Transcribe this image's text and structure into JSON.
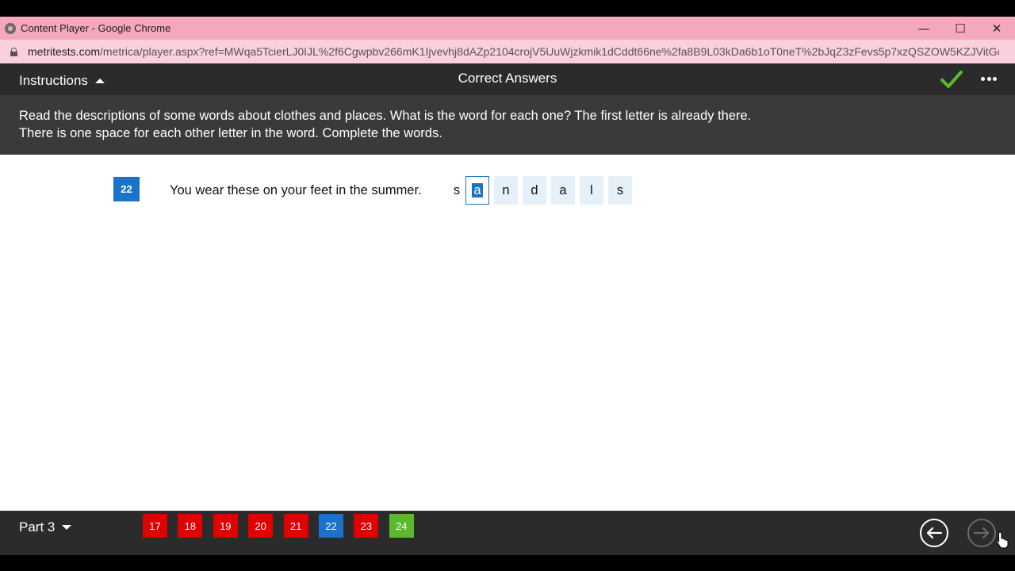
{
  "window": {
    "title": "Content Player - Google Chrome",
    "minimize_glyph": "—",
    "maximize_glyph": "☐",
    "close_glyph": "✕"
  },
  "browser": {
    "url_domain": "metritests.com",
    "url_path": "/metrica/player.aspx?ref=MWqa5TcierLJ0IJL%2f6Cgwpbv266mK1Ijvevhj8dAZp2104crojV5UuWjzkmik1dCddt66ne%2fa8B9L03kDa6b1oT0neT%2bJqZ3zFevs5p7xzQSZOW5KZJVitGoR..."
  },
  "header": {
    "instructions_label": "Instructions",
    "center_title": "Correct Answers",
    "check_color": "#5cb82d"
  },
  "banner": {
    "line1": "Read the descriptions of some words about clothes and places. What is the word for each one? The first letter is already there.",
    "line2": "There is one space for each other letter in the word. Complete the words."
  },
  "question": {
    "number": "22",
    "text": "You wear these on your feet in the summer.",
    "first_letter": "s",
    "letters": [
      "a",
      "n",
      "d",
      "a",
      "l",
      "s"
    ],
    "active_index": 0
  },
  "footer": {
    "part_label": "Part 3",
    "questions": [
      {
        "label": "17",
        "color": "#e00000"
      },
      {
        "label": "18",
        "color": "#e00000"
      },
      {
        "label": "19",
        "color": "#e00000"
      },
      {
        "label": "20",
        "color": "#e00000"
      },
      {
        "label": "21",
        "color": "#e00000"
      },
      {
        "label": "22",
        "color": "#1a73c8"
      },
      {
        "label": "23",
        "color": "#e00000"
      },
      {
        "label": "24",
        "color": "#5cb82d"
      }
    ]
  }
}
